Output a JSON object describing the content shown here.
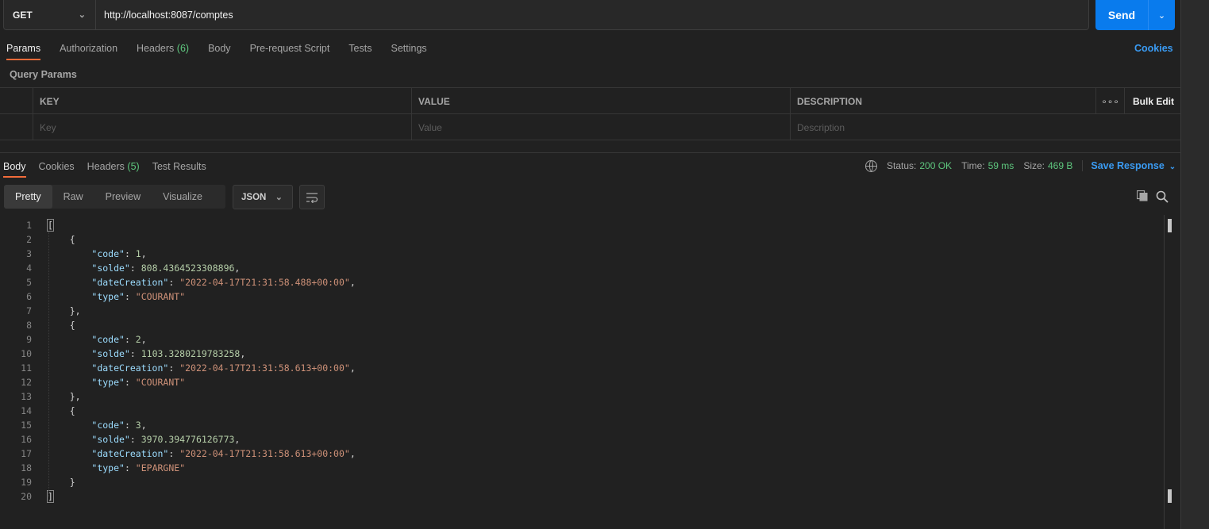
{
  "request": {
    "method": "GET",
    "url": "http://localhost:8087/comptes",
    "send_label": "Send"
  },
  "request_tabs": [
    {
      "label": "Params",
      "count": ""
    },
    {
      "label": "Authorization",
      "count": ""
    },
    {
      "label": "Headers",
      "count": "(6)"
    },
    {
      "label": "Body",
      "count": ""
    },
    {
      "label": "Pre-request Script",
      "count": ""
    },
    {
      "label": "Tests",
      "count": ""
    },
    {
      "label": "Settings",
      "count": ""
    }
  ],
  "cookies_link": "Cookies",
  "query_params": {
    "title": "Query Params",
    "headers": {
      "key": "KEY",
      "value": "VALUE",
      "description": "DESCRIPTION",
      "more": "∘∘∘",
      "bulk_edit": "Bulk Edit"
    },
    "placeholders": {
      "key": "Key",
      "value": "Value",
      "description": "Description"
    }
  },
  "response_tabs": [
    {
      "label": "Body",
      "count": ""
    },
    {
      "label": "Cookies",
      "count": ""
    },
    {
      "label": "Headers",
      "count": "(5)"
    },
    {
      "label": "Test Results",
      "count": ""
    }
  ],
  "status": {
    "status_label": "Status:",
    "status_value": "200 OK",
    "time_label": "Time:",
    "time_value": "59 ms",
    "size_label": "Size:",
    "size_value": "469 B",
    "save_response": "Save Response"
  },
  "view_tabs": [
    "Pretty",
    "Raw",
    "Preview",
    "Visualize"
  ],
  "format": "JSON",
  "colors": {
    "accent": "#097bed",
    "link": "#3a9bf3",
    "success": "#5ec77e",
    "active_tab": "#f26b3a"
  },
  "response_body": [
    {
      "code": 1,
      "solde": "808.4364523308896",
      "dateCreation": "2022-04-17T21:31:58.488+00:00",
      "type": "COURANT"
    },
    {
      "code": 2,
      "solde": "1103.3280219783258",
      "dateCreation": "2022-04-17T21:31:58.613+00:00",
      "type": "COURANT"
    },
    {
      "code": 3,
      "solde": "3970.394776126773",
      "dateCreation": "2022-04-17T21:31:58.613+00:00",
      "type": "EPARGNE"
    }
  ]
}
